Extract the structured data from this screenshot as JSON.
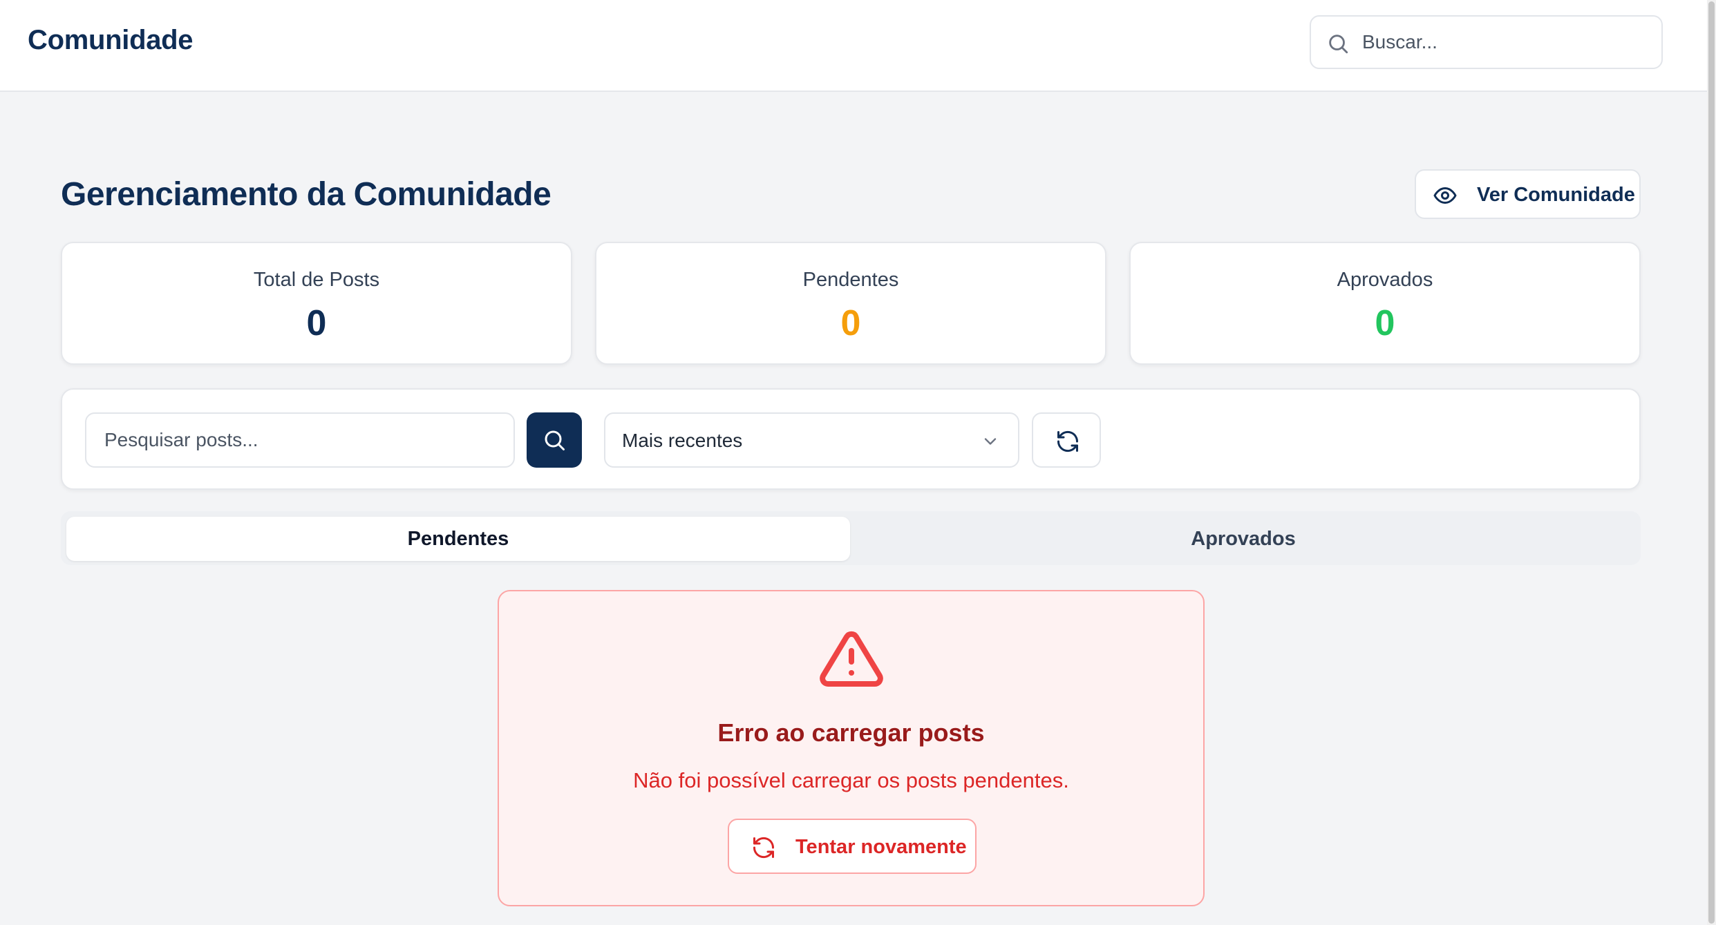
{
  "header": {
    "brand": "Comunidade",
    "search_placeholder": "Buscar..."
  },
  "page": {
    "title": "Gerenciamento da Comunidade",
    "view_button_label": "Ver Comunidade"
  },
  "stats": [
    {
      "label": "Total de Posts",
      "value": "0",
      "color": "#0f2d55"
    },
    {
      "label": "Pendentes",
      "value": "0",
      "color": "#f59e0b"
    },
    {
      "label": "Aprovados",
      "value": "0",
      "color": "#22c55e"
    }
  ],
  "filters": {
    "search_placeholder": "Pesquisar posts...",
    "sort_value": "Mais recentes",
    "search_icon": "search-icon",
    "refresh_icon": "refresh-icon"
  },
  "tabs": [
    {
      "label": "Pendentes",
      "active": true
    },
    {
      "label": "Aprovados",
      "active": false
    }
  ],
  "error": {
    "icon": "alert-triangle-icon",
    "title": "Erro ao carregar posts",
    "message": "Não foi possível carregar os posts pendentes.",
    "retry_label": "Tentar novamente"
  },
  "colors": {
    "primary": "#0f2d55",
    "error_text": "#dc2626",
    "error_title": "#991b1b",
    "error_bg": "#fef2f2",
    "error_border": "#fca5a5"
  }
}
